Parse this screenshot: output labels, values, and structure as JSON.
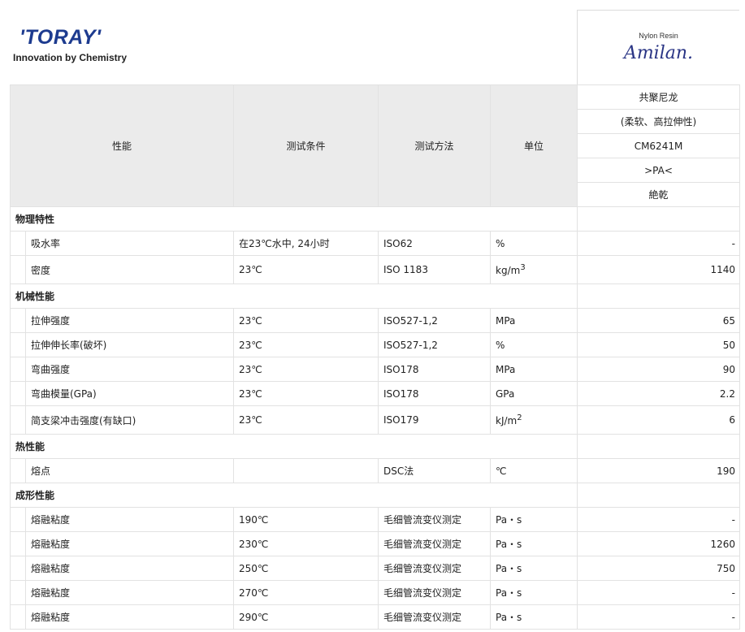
{
  "logo": {
    "name": "'TORAY'",
    "tagline": "Innovation by Chemistry"
  },
  "brand": {
    "label": "Nylon Resin",
    "name": "Amilan."
  },
  "header": {
    "col_property": "性能",
    "col_condition": "测试条件",
    "col_method": "测试方法",
    "col_unit": "单位",
    "product_lines": [
      "共聚尼龙",
      "(柔软、高拉伸性)",
      "CM6241M",
      ">PA<",
      "絶乾"
    ]
  },
  "sections": [
    {
      "title": "物理特性",
      "rows": [
        {
          "property": "吸水率",
          "condition": "在23℃水中, 24小时",
          "method": "ISO62",
          "unit": "%",
          "value": "-"
        },
        {
          "property": "密度",
          "condition": "23℃",
          "method": "ISO 1183",
          "unit": "kg/m",
          "unit_sup": "3",
          "value": "1140"
        }
      ]
    },
    {
      "title": "机械性能",
      "rows": [
        {
          "property": "拉伸强度",
          "condition": "23℃",
          "method": "ISO527-1,2",
          "unit": "MPa",
          "value": "65"
        },
        {
          "property": "拉伸伸长率(破坏)",
          "condition": "23℃",
          "method": "ISO527-1,2",
          "unit": "%",
          "value": "50"
        },
        {
          "property": "弯曲强度",
          "condition": "23℃",
          "method": "ISO178",
          "unit": "MPa",
          "value": "90"
        },
        {
          "property": "弯曲模量(GPa)",
          "condition": "23℃",
          "method": "ISO178",
          "unit": "GPa",
          "value": "2.2"
        },
        {
          "property": "简支梁冲击强度(有缺口)",
          "condition": "23℃",
          "method": "ISO179",
          "unit": "kJ/m",
          "unit_sup": "2",
          "value": "6"
        }
      ]
    },
    {
      "title": "热性能",
      "rows": [
        {
          "property": "熔点",
          "condition": "",
          "method": "DSC法",
          "unit": "℃",
          "value": "190"
        }
      ]
    },
    {
      "title": "成形性能",
      "rows": [
        {
          "property": "熔融粘度",
          "condition": "190℃",
          "method": "毛细管流变仪测定",
          "unit": "Pa・s",
          "value": "-"
        },
        {
          "property": "熔融粘度",
          "condition": "230℃",
          "method": "毛细管流变仪测定",
          "unit": "Pa・s",
          "value": "1260"
        },
        {
          "property": "熔融粘度",
          "condition": "250℃",
          "method": "毛细管流变仪测定",
          "unit": "Pa・s",
          "value": "750"
        },
        {
          "property": "熔融粘度",
          "condition": "270℃",
          "method": "毛细管流变仪测定",
          "unit": "Pa・s",
          "value": "-"
        },
        {
          "property": "熔融粘度",
          "condition": "290℃",
          "method": "毛细管流变仪测定",
          "unit": "Pa・s",
          "value": "-"
        }
      ]
    }
  ]
}
